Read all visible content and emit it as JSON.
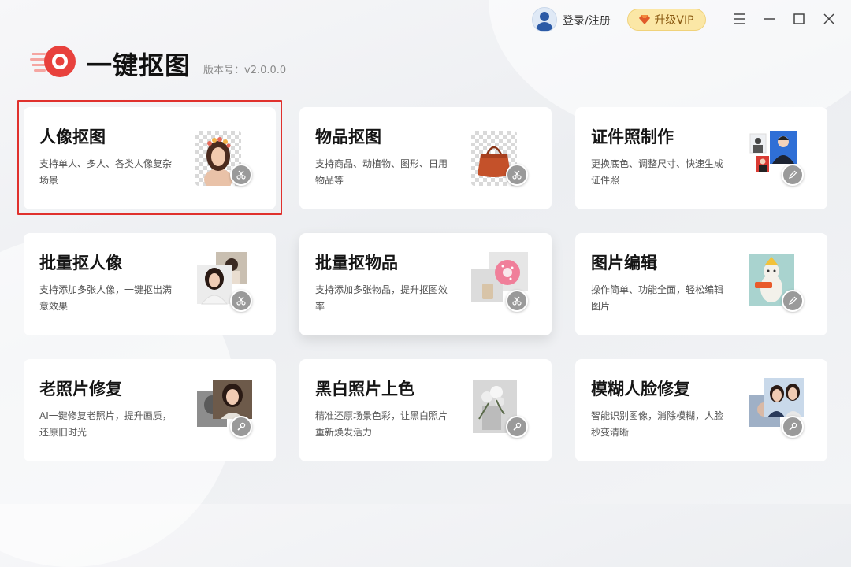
{
  "header": {
    "login_label": "登录/注册",
    "vip_label": "升级VIP",
    "app_title": "一键抠图",
    "version_label": "版本号：v2.0.0.0"
  },
  "colors": {
    "brand_red": "#e8413d",
    "vip_gold": "#fbe7a6",
    "selection_red": "#e0312d"
  },
  "cards": [
    {
      "title": "人像抠图",
      "desc": "支持单人、多人、各类人像复杂场景",
      "icon": "scissors-icon",
      "selected": true
    },
    {
      "title": "物品抠图",
      "desc": "支持商品、动植物、图形、日用物品等",
      "icon": "scissors-icon"
    },
    {
      "title": "证件照制作",
      "desc": "更换底色、调整尺寸、快速生成证件照",
      "icon": "pencil-icon"
    },
    {
      "title": "批量抠人像",
      "desc": "支持添加多张人像，一键抠出满意效果",
      "icon": "scissors-icon"
    },
    {
      "title": "批量抠物品",
      "desc": "支持添加多张物品，提升抠图效率",
      "icon": "scissors-icon",
      "hover": true
    },
    {
      "title": "图片编辑",
      "desc": "操作简单、功能全面，轻松编辑图片",
      "icon": "pencil-icon"
    },
    {
      "title": "老照片修复",
      "desc": "AI一键修复老照片，提升画质，还原旧时光",
      "icon": "wrench-icon"
    },
    {
      "title": "黑白照片上色",
      "desc": "精准还原场景色彩，让黑白照片重新焕发活力",
      "icon": "wrench-icon"
    },
    {
      "title": "模糊人脸修复",
      "desc": "智能识别图像，消除模糊，人脸秒变清晰",
      "icon": "wrench-icon"
    }
  ]
}
